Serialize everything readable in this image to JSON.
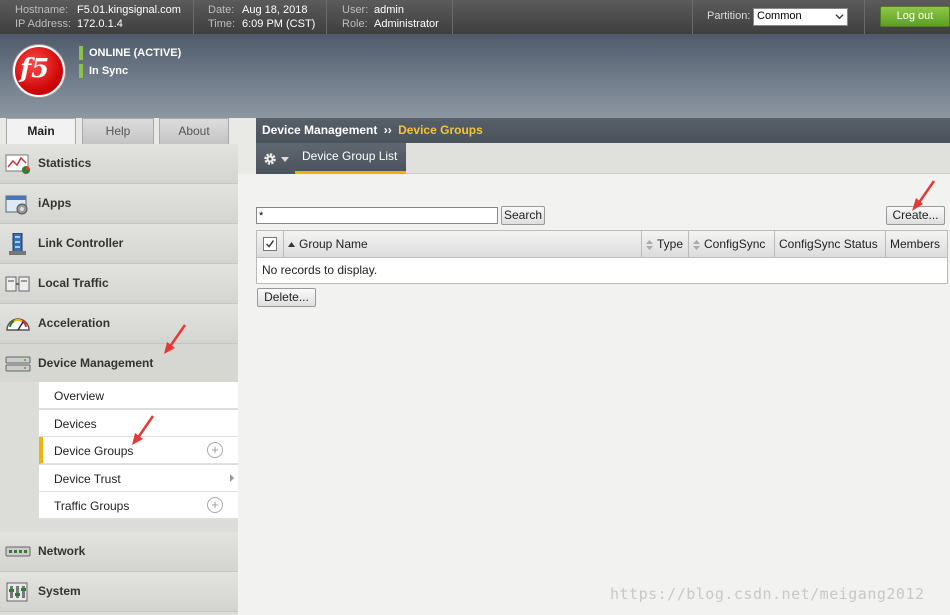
{
  "topbar": {
    "hostname_label": "Hostname:",
    "hostname": "F5.01.kingsignal.com",
    "ip_label": "IP Address:",
    "ip": "172.0.1.4",
    "date_label": "Date:",
    "date": "Aug 18, 2018",
    "time_label": "Time:",
    "time": "6:09 PM (CST)",
    "user_label": "User:",
    "user": "admin",
    "role_label": "Role:",
    "role": "Administrator",
    "partition_label": "Partition:",
    "partition_value": "Common",
    "logout": "Log out"
  },
  "banner": {
    "logo": "f5",
    "status1": "ONLINE (ACTIVE)",
    "status2": "In Sync"
  },
  "tabs": [
    "Main",
    "Help",
    "About"
  ],
  "sidebar": {
    "items": [
      {
        "label": "Statistics",
        "icon": "statistics-icon"
      },
      {
        "label": "iApps",
        "icon": "iapps-icon"
      },
      {
        "label": "Link Controller",
        "icon": "link-controller-icon"
      },
      {
        "label": "Local Traffic",
        "icon": "local-traffic-icon"
      },
      {
        "label": "Acceleration",
        "icon": "acceleration-icon"
      },
      {
        "label": "Device Management",
        "icon": "device-management-icon"
      },
      {
        "label": "Network",
        "icon": "network-icon"
      },
      {
        "label": "System",
        "icon": "system-icon"
      }
    ],
    "sub_items": [
      "Overview",
      "Devices",
      "Device Groups",
      "Device Trust",
      "Traffic Groups"
    ]
  },
  "breadcrumb": {
    "section": "Device Management",
    "separator": "››",
    "current": "Device Groups"
  },
  "subnav": {
    "tab": "Device Group List"
  },
  "search": {
    "value": "*",
    "button": "Search"
  },
  "create_button": "Create...",
  "table": {
    "columns": [
      "Group Name",
      "Type",
      "ConfigSync",
      "ConfigSync Status",
      "Members"
    ],
    "empty": "No records to display."
  },
  "delete_button": "Delete...",
  "watermark": "https://blog.csdn.net/meigang2012",
  "colors": {
    "accent": "#f0b400",
    "logout": "#6fae2e",
    "status": "#8bc34a",
    "annotation": "#e53935"
  }
}
